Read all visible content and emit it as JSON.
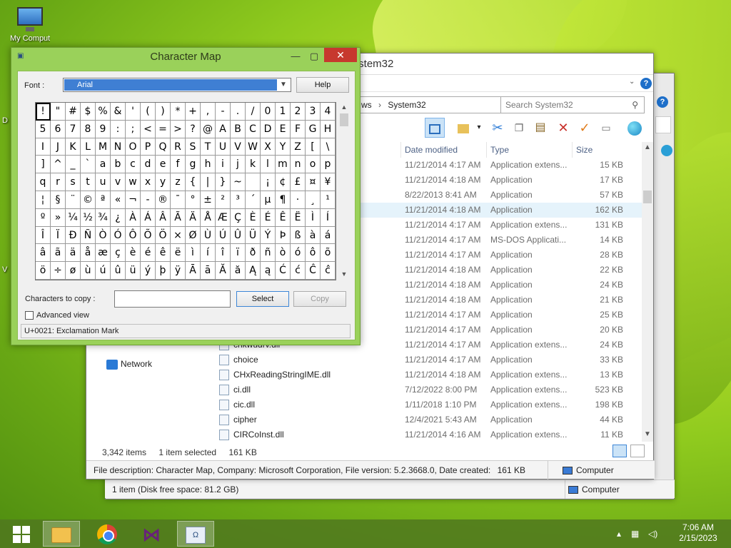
{
  "desktop": {
    "icon_label": "My Computer",
    "side_letters": [
      "D",
      "V"
    ]
  },
  "explorer": {
    "title": "System32",
    "breadcrumb_prefix": "ws",
    "breadcrumb_current": "System32",
    "search_placeholder": "Search System32",
    "columns": [
      "Date modified",
      "Type",
      "Size"
    ],
    "rows": [
      {
        "name": "",
        "date": "11/21/2014 4:17 AM",
        "type": "Application extens...",
        "size": "15 KB"
      },
      {
        "name": "",
        "date": "11/21/2014 4:18 AM",
        "type": "Application",
        "size": "17 KB"
      },
      {
        "name": "",
        "date": "8/22/2013 8:41 AM",
        "type": "Application",
        "size": "57 KB"
      },
      {
        "name": "",
        "date": "11/21/2014 4:18 AM",
        "type": "Application",
        "size": "162 KB"
      },
      {
        "name": "",
        "date": "11/21/2014 4:17 AM",
        "type": "Application extens...",
        "size": "131 KB"
      },
      {
        "name": "",
        "date": "11/21/2014 4:17 AM",
        "type": "MS-DOS Applicati...",
        "size": "14 KB"
      },
      {
        "name": "",
        "date": "11/21/2014 4:17 AM",
        "type": "Application",
        "size": "28 KB"
      },
      {
        "name": "",
        "date": "11/21/2014 4:18 AM",
        "type": "Application",
        "size": "22 KB"
      },
      {
        "name": "",
        "date": "11/21/2014 4:18 AM",
        "type": "Application",
        "size": "24 KB"
      },
      {
        "name": "",
        "date": "11/21/2014 4:18 AM",
        "type": "Application",
        "size": "21 KB"
      },
      {
        "name": "",
        "date": "11/21/2014 4:17 AM",
        "type": "Application",
        "size": "25 KB"
      },
      {
        "name": "",
        "date": "11/21/2014 4:17 AM",
        "type": "Application",
        "size": "20 KB"
      },
      {
        "name": "chkwudrv.dll",
        "date": "11/21/2014 4:17 AM",
        "type": "Application extens...",
        "size": "24 KB"
      },
      {
        "name": "choice",
        "date": "11/21/2014 4:17 AM",
        "type": "Application",
        "size": "33 KB"
      },
      {
        "name": "CHxReadingStringIME.dll",
        "date": "11/21/2014 4:18 AM",
        "type": "Application extens...",
        "size": "13 KB"
      },
      {
        "name": "ci.dll",
        "date": "7/12/2022 8:00 PM",
        "type": "Application extens...",
        "size": "523 KB"
      },
      {
        "name": "cic.dll",
        "date": "1/11/2018 1:10 PM",
        "type": "Application extens...",
        "size": "198 KB"
      },
      {
        "name": "cipher",
        "date": "12/4/2021 5:43 AM",
        "type": "Application",
        "size": "44 KB"
      },
      {
        "name": "CIRCoInst.dll",
        "date": "11/21/2014 4:16 AM",
        "type": "Application extens...",
        "size": "11 KB"
      }
    ],
    "nav_network": "Network",
    "status": {
      "items": "3,342 items",
      "selected": "1 item selected",
      "selected_size": "161 KB"
    },
    "details_bar": "File description: Character Map, Company: Microsoft Corporation, File version: 5.2.3668.0, Date created:",
    "details_size": "161 KB",
    "computer_label": "Computer",
    "back_status": "1 item (Disk free space: 81.2 GB)",
    "back_computer_label": "Computer"
  },
  "charmap": {
    "title": "Character Map",
    "font_label": "Font :",
    "font_value": "Arial",
    "help_label": "Help",
    "chars": [
      "!",
      "\"",
      "#",
      "$",
      "%",
      "&",
      "'",
      "(",
      ")",
      "*",
      "+",
      ",",
      "-",
      ".",
      "/",
      "0",
      "1",
      "2",
      "3",
      "4",
      "5",
      "6",
      "7",
      "8",
      "9",
      ":",
      ";",
      "<",
      "=",
      ">",
      "?",
      "@",
      "A",
      "B",
      "C",
      "D",
      "E",
      "F",
      "G",
      "H",
      "I",
      "J",
      "K",
      "L",
      "M",
      "N",
      "O",
      "P",
      "Q",
      "R",
      "S",
      "T",
      "U",
      "V",
      "W",
      "X",
      "Y",
      "Z",
      "[",
      "\\",
      "]",
      "^",
      "_",
      "`",
      "a",
      "b",
      "c",
      "d",
      "e",
      "f",
      "g",
      "h",
      "i",
      "j",
      "k",
      "l",
      "m",
      "n",
      "o",
      "p",
      "q",
      "r",
      "s",
      "t",
      "u",
      "v",
      "w",
      "x",
      "y",
      "z",
      "{",
      "|",
      "}",
      "~",
      " ",
      "¡",
      "¢",
      "£",
      "¤",
      "¥",
      "¦",
      "§",
      "¨",
      "©",
      "ª",
      "«",
      "¬",
      "-",
      "®",
      "¯",
      "°",
      "±",
      "²",
      "³",
      "´",
      "µ",
      "¶",
      "·",
      "¸",
      "¹",
      "º",
      "»",
      "¼",
      "½",
      "¾",
      "¿",
      "À",
      "Á",
      "Â",
      "Ã",
      "Ä",
      "Å",
      "Æ",
      "Ç",
      "È",
      "É",
      "Ê",
      "Ë",
      "Ì",
      "Í",
      "Î",
      "Ï",
      "Ð",
      "Ñ",
      "Ò",
      "Ó",
      "Ô",
      "Õ",
      "Ö",
      "×",
      "Ø",
      "Ù",
      "Ú",
      "Û",
      "Ü",
      "Ý",
      "Þ",
      "ß",
      "à",
      "á",
      "â",
      "ã",
      "ä",
      "å",
      "æ",
      "ç",
      "è",
      "é",
      "ê",
      "ë",
      "ì",
      "í",
      "î",
      "ï",
      "ð",
      "ñ",
      "ò",
      "ó",
      "ô",
      "õ",
      "ö",
      "÷",
      "ø",
      "ù",
      "ú",
      "û",
      "ü",
      "ý",
      "þ",
      "ÿ",
      "Ā",
      "ā",
      "Ă",
      "ă",
      "Ą",
      "ą",
      "Ć",
      "ć",
      "Ĉ",
      "ĉ"
    ],
    "selected_index": 0,
    "copy_label": "Characters to copy :",
    "copy_value": "",
    "select_label": "Select",
    "copy_button_label": "Copy",
    "advanced_label": "Advanced view",
    "status": "U+0021: Exclamation Mark"
  },
  "taskbar": {
    "time": "7:06 AM",
    "date": "2/15/2023"
  },
  "colors": {
    "accent": "#3f7fd3",
    "close": "#c7382e",
    "charmap_frame": "#9ad15a"
  }
}
